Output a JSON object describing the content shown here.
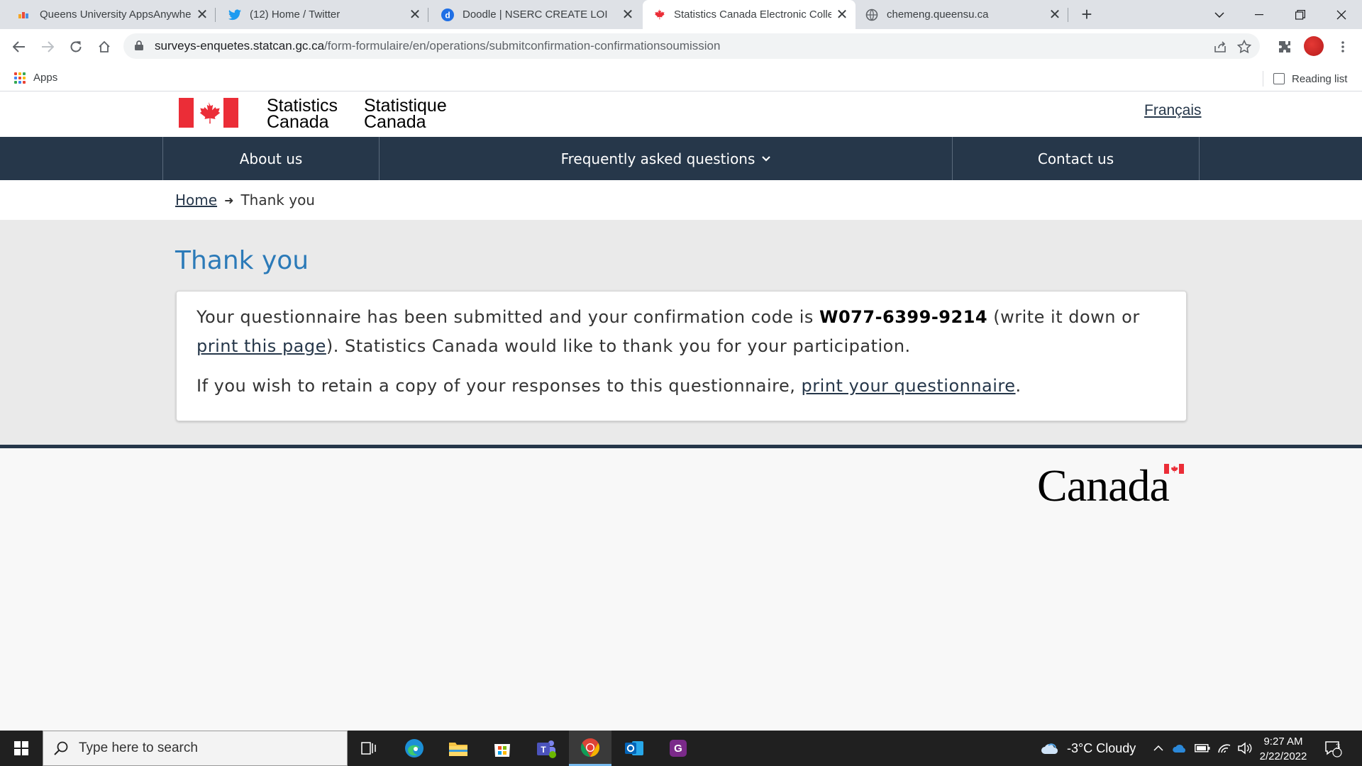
{
  "browser": {
    "tabs": [
      {
        "title": "Queens University AppsAnywhere",
        "active": false
      },
      {
        "title": "(12) Home / Twitter",
        "active": false
      },
      {
        "title": "Doodle | NSERC CREATE LOI",
        "active": false
      },
      {
        "title": "Statistics Canada Electronic Collection",
        "active": true
      },
      {
        "title": "chemeng.queensu.ca",
        "active": false
      }
    ],
    "url_host": "surveys-enquetes.statcan.gc.ca",
    "url_path": "/form-formulaire/en/operations/submitconfirmation-confirmationsoumission",
    "bookmarks": {
      "apps_label": "Apps",
      "reading_list_label": "Reading list"
    }
  },
  "site": {
    "wordmark_en": [
      "Statistics",
      "Canada"
    ],
    "wordmark_fr": [
      "Statistique",
      "Canada"
    ],
    "language_link": "Français",
    "nav": [
      {
        "label": "About us"
      },
      {
        "label": "Frequently asked questions",
        "has_dropdown": true
      },
      {
        "label": "Contact us"
      }
    ],
    "breadcrumb": {
      "home": "Home",
      "current": "Thank you"
    }
  },
  "main": {
    "title": "Thank you",
    "message_prefix": "Your questionnaire has been submitted and your confirmation code is ",
    "confirmation_code": "W077-6399-9214",
    "message_mid": " (write it down or ",
    "print_page_link": "print this page",
    "message_suffix": "). Statistics Canada would like to thank you for your participation.",
    "retain_prefix": "If you wish to retain a copy of your responses to this questionnaire, ",
    "print_questionnaire_link": "print your questionnaire",
    "retain_suffix": "."
  },
  "footer": {
    "wordmark": "Canada"
  },
  "taskbar": {
    "search_placeholder": "Type here to search",
    "weather": "-3°C  Cloudy",
    "time": "9:27 AM",
    "date": "2/22/2022",
    "notification_count": "3"
  },
  "colors": {
    "nav_bg": "#26374a",
    "heading_blue": "#2b7ab8",
    "flag_red": "#eb2d37"
  }
}
